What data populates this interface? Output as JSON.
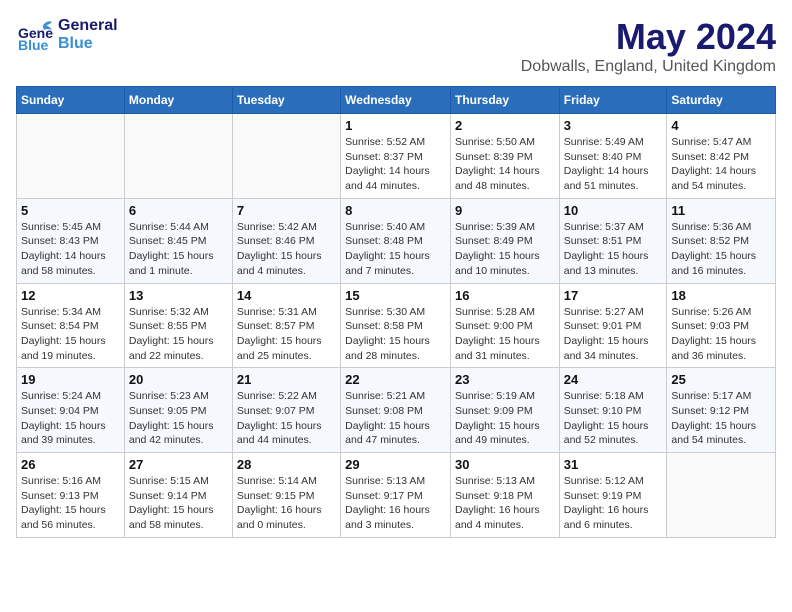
{
  "header": {
    "logo_general": "General",
    "logo_blue": "Blue",
    "title": "May 2024",
    "subtitle": "Dobwalls, England, United Kingdom"
  },
  "weekdays": [
    "Sunday",
    "Monday",
    "Tuesday",
    "Wednesday",
    "Thursday",
    "Friday",
    "Saturday"
  ],
  "weeks": [
    [
      {
        "day": "",
        "info": ""
      },
      {
        "day": "",
        "info": ""
      },
      {
        "day": "",
        "info": ""
      },
      {
        "day": "1",
        "info": "Sunrise: 5:52 AM\nSunset: 8:37 PM\nDaylight: 14 hours\nand 44 minutes."
      },
      {
        "day": "2",
        "info": "Sunrise: 5:50 AM\nSunset: 8:39 PM\nDaylight: 14 hours\nand 48 minutes."
      },
      {
        "day": "3",
        "info": "Sunrise: 5:49 AM\nSunset: 8:40 PM\nDaylight: 14 hours\nand 51 minutes."
      },
      {
        "day": "4",
        "info": "Sunrise: 5:47 AM\nSunset: 8:42 PM\nDaylight: 14 hours\nand 54 minutes."
      }
    ],
    [
      {
        "day": "5",
        "info": "Sunrise: 5:45 AM\nSunset: 8:43 PM\nDaylight: 14 hours\nand 58 minutes."
      },
      {
        "day": "6",
        "info": "Sunrise: 5:44 AM\nSunset: 8:45 PM\nDaylight: 15 hours\nand 1 minute."
      },
      {
        "day": "7",
        "info": "Sunrise: 5:42 AM\nSunset: 8:46 PM\nDaylight: 15 hours\nand 4 minutes."
      },
      {
        "day": "8",
        "info": "Sunrise: 5:40 AM\nSunset: 8:48 PM\nDaylight: 15 hours\nand 7 minutes."
      },
      {
        "day": "9",
        "info": "Sunrise: 5:39 AM\nSunset: 8:49 PM\nDaylight: 15 hours\nand 10 minutes."
      },
      {
        "day": "10",
        "info": "Sunrise: 5:37 AM\nSunset: 8:51 PM\nDaylight: 15 hours\nand 13 minutes."
      },
      {
        "day": "11",
        "info": "Sunrise: 5:36 AM\nSunset: 8:52 PM\nDaylight: 15 hours\nand 16 minutes."
      }
    ],
    [
      {
        "day": "12",
        "info": "Sunrise: 5:34 AM\nSunset: 8:54 PM\nDaylight: 15 hours\nand 19 minutes."
      },
      {
        "day": "13",
        "info": "Sunrise: 5:32 AM\nSunset: 8:55 PM\nDaylight: 15 hours\nand 22 minutes."
      },
      {
        "day": "14",
        "info": "Sunrise: 5:31 AM\nSunset: 8:57 PM\nDaylight: 15 hours\nand 25 minutes."
      },
      {
        "day": "15",
        "info": "Sunrise: 5:30 AM\nSunset: 8:58 PM\nDaylight: 15 hours\nand 28 minutes."
      },
      {
        "day": "16",
        "info": "Sunrise: 5:28 AM\nSunset: 9:00 PM\nDaylight: 15 hours\nand 31 minutes."
      },
      {
        "day": "17",
        "info": "Sunrise: 5:27 AM\nSunset: 9:01 PM\nDaylight: 15 hours\nand 34 minutes."
      },
      {
        "day": "18",
        "info": "Sunrise: 5:26 AM\nSunset: 9:03 PM\nDaylight: 15 hours\nand 36 minutes."
      }
    ],
    [
      {
        "day": "19",
        "info": "Sunrise: 5:24 AM\nSunset: 9:04 PM\nDaylight: 15 hours\nand 39 minutes."
      },
      {
        "day": "20",
        "info": "Sunrise: 5:23 AM\nSunset: 9:05 PM\nDaylight: 15 hours\nand 42 minutes."
      },
      {
        "day": "21",
        "info": "Sunrise: 5:22 AM\nSunset: 9:07 PM\nDaylight: 15 hours\nand 44 minutes."
      },
      {
        "day": "22",
        "info": "Sunrise: 5:21 AM\nSunset: 9:08 PM\nDaylight: 15 hours\nand 47 minutes."
      },
      {
        "day": "23",
        "info": "Sunrise: 5:19 AM\nSunset: 9:09 PM\nDaylight: 15 hours\nand 49 minutes."
      },
      {
        "day": "24",
        "info": "Sunrise: 5:18 AM\nSunset: 9:10 PM\nDaylight: 15 hours\nand 52 minutes."
      },
      {
        "day": "25",
        "info": "Sunrise: 5:17 AM\nSunset: 9:12 PM\nDaylight: 15 hours\nand 54 minutes."
      }
    ],
    [
      {
        "day": "26",
        "info": "Sunrise: 5:16 AM\nSunset: 9:13 PM\nDaylight: 15 hours\nand 56 minutes."
      },
      {
        "day": "27",
        "info": "Sunrise: 5:15 AM\nSunset: 9:14 PM\nDaylight: 15 hours\nand 58 minutes."
      },
      {
        "day": "28",
        "info": "Sunrise: 5:14 AM\nSunset: 9:15 PM\nDaylight: 16 hours\nand 0 minutes."
      },
      {
        "day": "29",
        "info": "Sunrise: 5:13 AM\nSunset: 9:17 PM\nDaylight: 16 hours\nand 3 minutes."
      },
      {
        "day": "30",
        "info": "Sunrise: 5:13 AM\nSunset: 9:18 PM\nDaylight: 16 hours\nand 4 minutes."
      },
      {
        "day": "31",
        "info": "Sunrise: 5:12 AM\nSunset: 9:19 PM\nDaylight: 16 hours\nand 6 minutes."
      },
      {
        "day": "",
        "info": ""
      }
    ]
  ]
}
